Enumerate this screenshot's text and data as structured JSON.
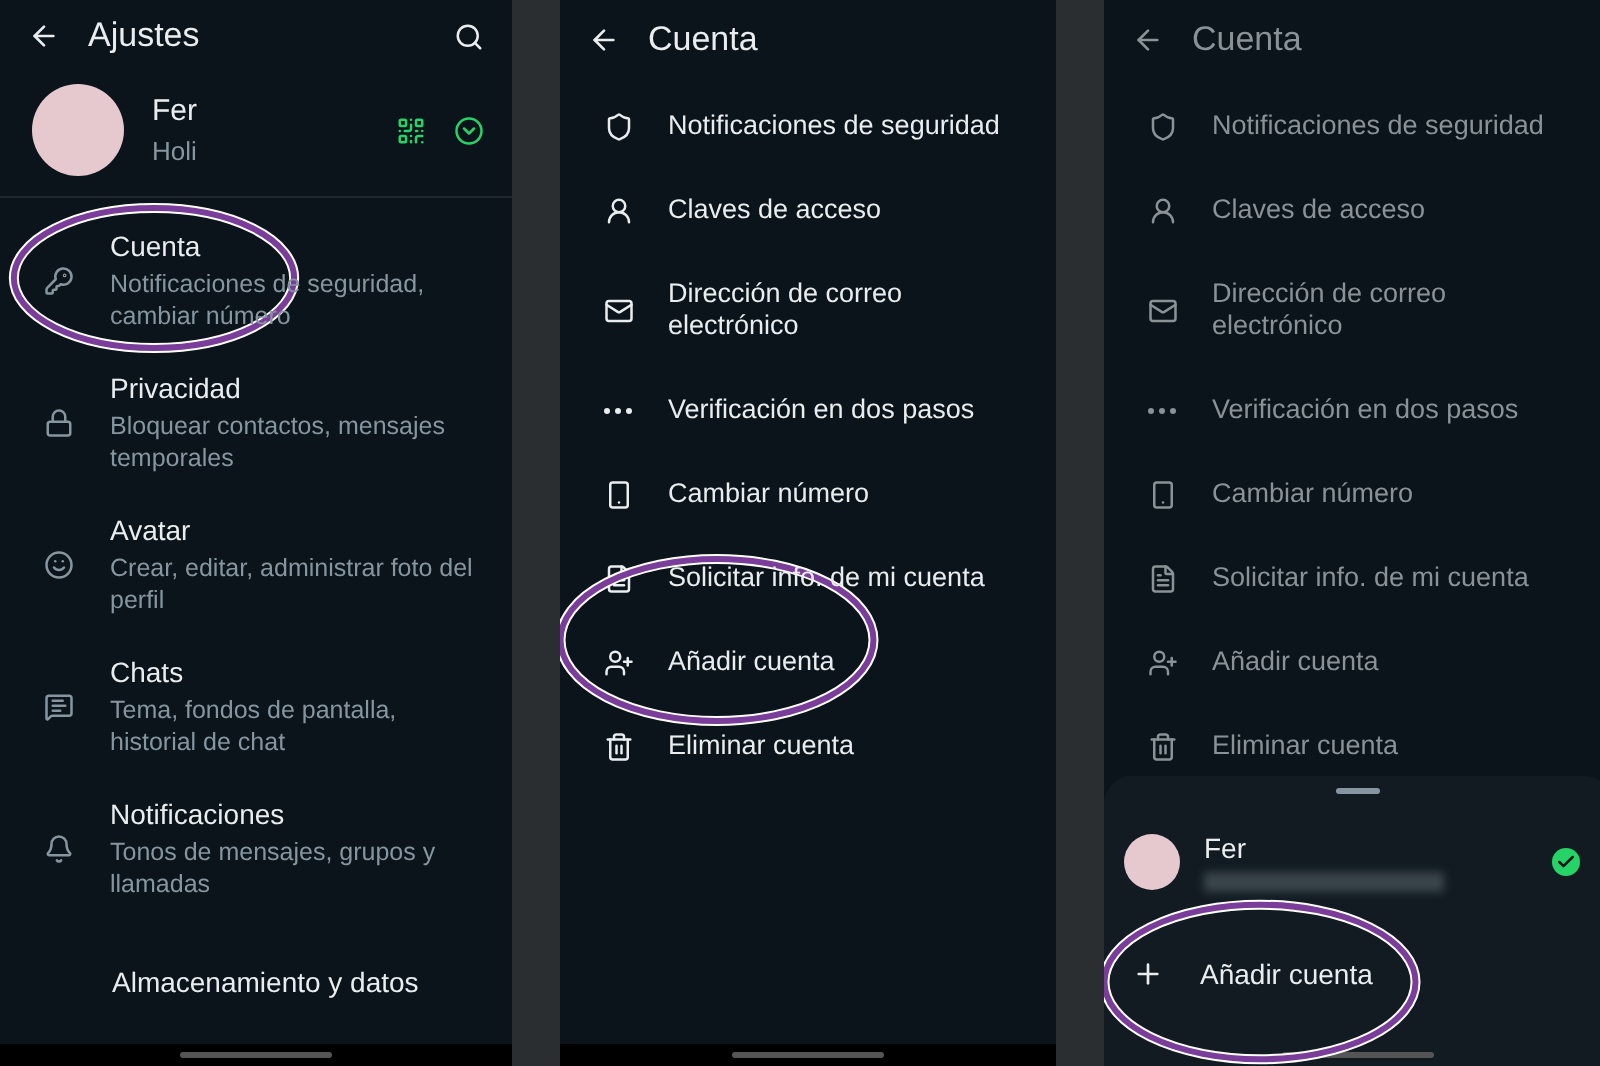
{
  "settings": {
    "title": "Ajustes",
    "profile": {
      "name": "Fer",
      "status": "Holi"
    },
    "items": [
      {
        "title": "Cuenta",
        "subtitle": "Notificaciones de seguridad, cambiar número",
        "circled": true
      },
      {
        "title": "Privacidad",
        "subtitle": "Bloquear contactos, mensajes temporales",
        "circled": false
      },
      {
        "title": "Avatar",
        "subtitle": "Crear, editar, administrar foto del perfil",
        "circled": false
      },
      {
        "title": "Chats",
        "subtitle": "Tema, fondos de pantalla, historial de chat",
        "circled": false
      },
      {
        "title": "Notificaciones",
        "subtitle": "Tonos de mensajes, grupos y llamadas",
        "circled": false
      },
      {
        "title": "Almacenamiento y datos",
        "circled": false
      }
    ]
  },
  "account_screens": [
    {
      "title": "Cuenta",
      "dimmed": false,
      "items": [
        {
          "label": "Notificaciones de seguridad",
          "circled": false
        },
        {
          "label": "Claves de acceso",
          "circled": false
        },
        {
          "label": "Dirección de correo electrónico",
          "circled": false
        },
        {
          "label": "Verificación en dos pasos",
          "circled": false
        },
        {
          "label": "Cambiar número",
          "circled": false
        },
        {
          "label": "Solicitar info. de mi cuenta",
          "circled": false
        },
        {
          "label": "Añadir cuenta",
          "circled": true
        },
        {
          "label": "Eliminar cuenta",
          "circled": false
        }
      ]
    },
    {
      "title": "Cuenta",
      "dimmed": true,
      "items": [
        {
          "label": "Notificaciones de seguridad",
          "circled": false
        },
        {
          "label": "Claves de acceso",
          "circled": false
        },
        {
          "label": "Dirección de correo electrónico",
          "circled": false
        },
        {
          "label": "Verificación en dos pasos",
          "circled": false
        },
        {
          "label": "Cambiar número",
          "circled": false
        },
        {
          "label": "Solicitar info. de mi cuenta",
          "circled": false
        },
        {
          "label": "Añadir cuenta",
          "circled": false
        },
        {
          "label": "Eliminar cuenta",
          "circled": false
        }
      ],
      "sheet": {
        "accounts": [
          {
            "name": "Fer",
            "selected": true
          }
        ],
        "add": {
          "label": "Añadir cuenta",
          "circled": true
        }
      }
    }
  ]
}
